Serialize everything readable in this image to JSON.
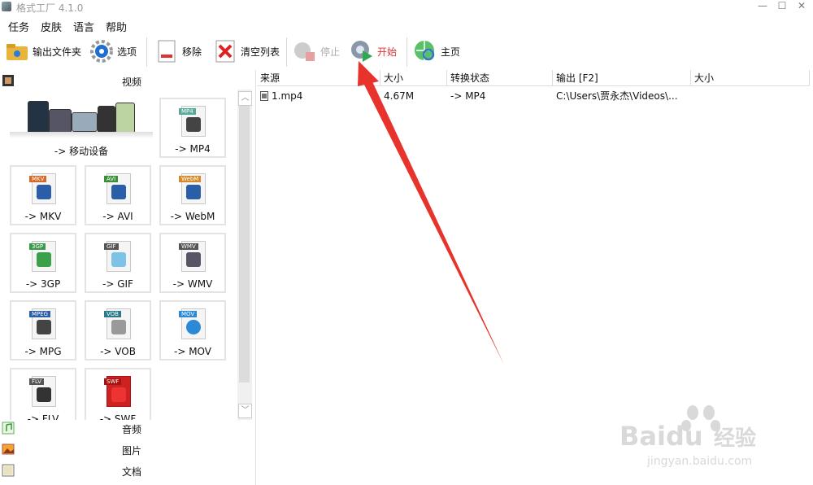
{
  "window": {
    "title": "格式工厂 4.1.0",
    "controls": [
      "—",
      "☐",
      "✕"
    ]
  },
  "menu": [
    "任务",
    "皮肤",
    "语言",
    "帮助"
  ],
  "toolbar": {
    "output_folder": "输出文件夹",
    "options": "选项",
    "remove": "移除",
    "clear_list": "清空列表",
    "stop": "停止",
    "start": "开始",
    "home": "主页"
  },
  "sidebar": {
    "video_header": "视频",
    "tiles": [
      {
        "label": "-> 移动设备"
      },
      {
        "label": "-> MP4",
        "tag": "MP4"
      },
      {
        "label": "-> MKV",
        "tag": "MKV"
      },
      {
        "label": "-> AVI",
        "tag": "AVI"
      },
      {
        "label": "-> WebM",
        "tag": "WebM"
      },
      {
        "label": "-> 3GP",
        "tag": "3GP"
      },
      {
        "label": "-> GIF",
        "tag": "GIF"
      },
      {
        "label": "-> WMV",
        "tag": "WMV"
      },
      {
        "label": "-> MPG",
        "tag": "MPEG"
      },
      {
        "label": "-> VOB",
        "tag": "VOB"
      },
      {
        "label": "-> MOV",
        "tag": "MOV"
      },
      {
        "label": "-> FLV",
        "tag": "FLV"
      },
      {
        "label": "-> SWF",
        "tag": "SWF"
      }
    ],
    "audio_header": "音频",
    "image_header": "图片",
    "document_header": "文档"
  },
  "list": {
    "columns": [
      "来源",
      "大小",
      "转换状态",
      "输出 [F2]",
      "大小"
    ],
    "rows": [
      {
        "source": "1.mp4",
        "size": "4.67M",
        "status": "-> MP4",
        "output": "C:\\Users\\贾永杰\\Videos\\...",
        "out_size": ""
      }
    ]
  },
  "watermark": {
    "brand": "Baidu",
    "brand_cn": "经验",
    "url": "jingyan.baidu.com"
  },
  "colors": {
    "accent_red": "#e8322c",
    "start_green": "#2fa84f"
  }
}
